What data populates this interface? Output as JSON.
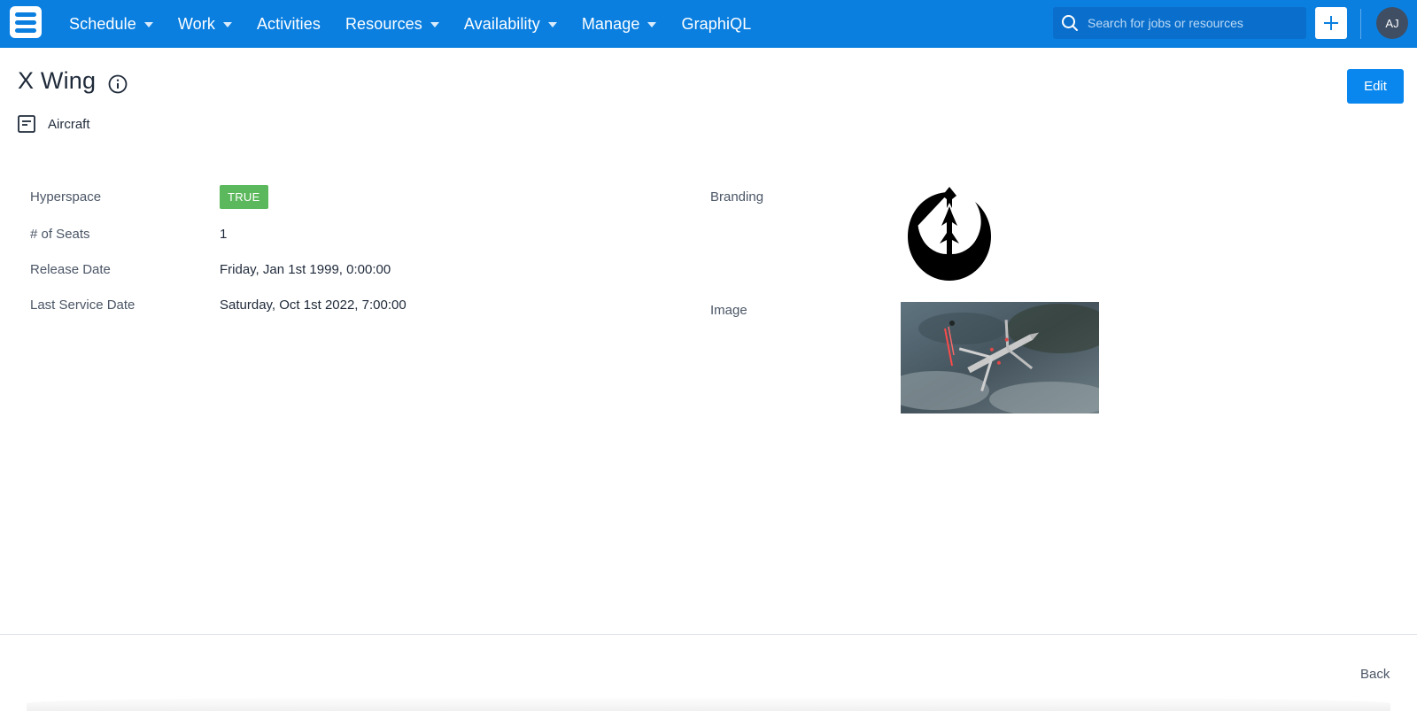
{
  "nav": {
    "items": [
      {
        "label": "Schedule",
        "has_dropdown": true
      },
      {
        "label": "Work",
        "has_dropdown": true
      },
      {
        "label": "Activities",
        "has_dropdown": false
      },
      {
        "label": "Resources",
        "has_dropdown": true
      },
      {
        "label": "Availability",
        "has_dropdown": true
      },
      {
        "label": "Manage",
        "has_dropdown": true
      },
      {
        "label": "GraphiQL",
        "has_dropdown": false
      }
    ],
    "search_placeholder": "Search for jobs or resources",
    "avatar_initials": "AJ",
    "accent_color": "#0a7fe0"
  },
  "page": {
    "title": "X Wing",
    "type_label": "Aircraft",
    "edit_label": "Edit"
  },
  "fields": {
    "hyperspace": {
      "label": "Hyperspace",
      "value": "TRUE",
      "badge_color": "#5cb85c"
    },
    "seats": {
      "label": "# of Seats",
      "value": "1"
    },
    "release_date": {
      "label": "Release Date",
      "value": "Friday, Jan 1st 1999, 0:00:00"
    },
    "last_service_date": {
      "label": "Last Service Date",
      "value": "Saturday, Oct 1st 2022, 7:00:00"
    },
    "branding": {
      "label": "Branding",
      "icon": "rebel-alliance-logo"
    },
    "image": {
      "label": "Image",
      "icon": "x-wing-photo"
    }
  },
  "footer": {
    "back_label": "Back"
  }
}
